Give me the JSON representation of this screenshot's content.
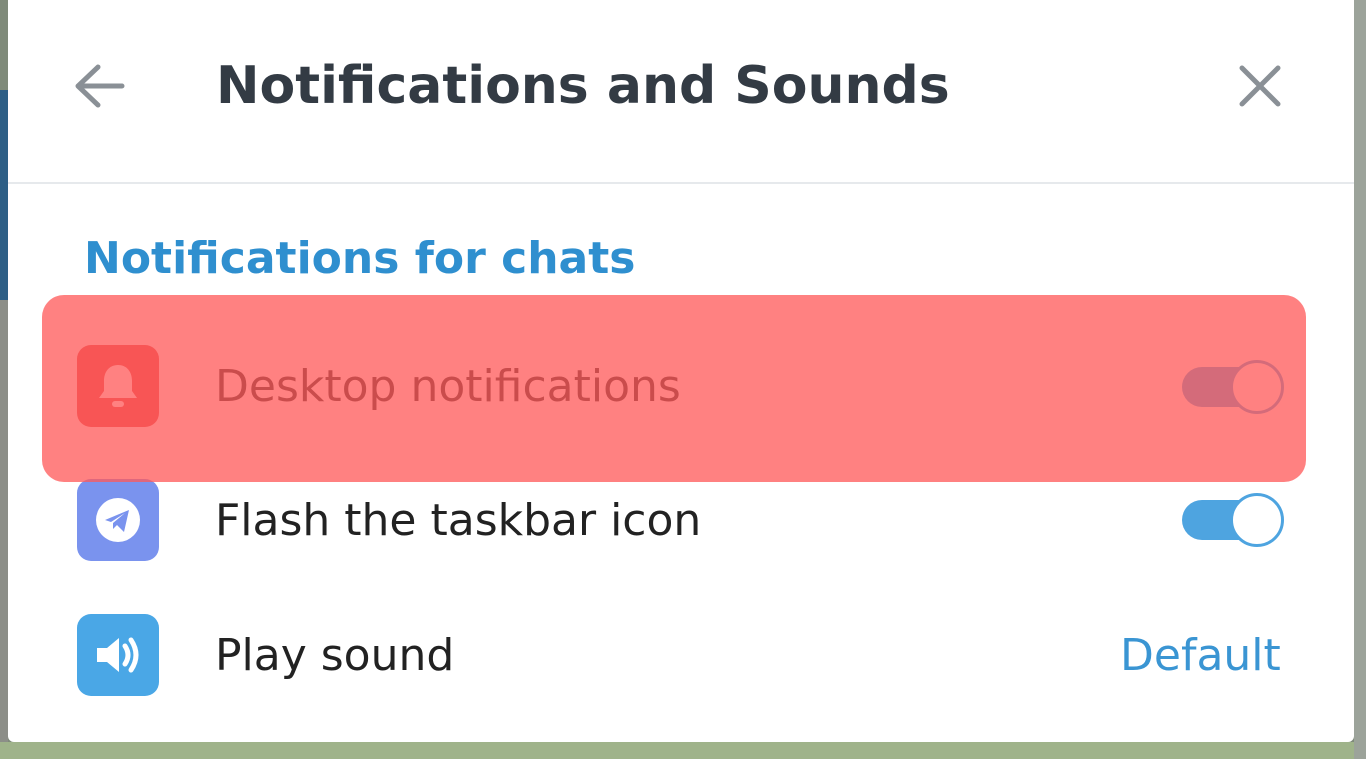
{
  "header": {
    "title": "Notifications and Sounds"
  },
  "section": {
    "title": "Notifications for chats"
  },
  "rows": [
    {
      "label": "Desktop notifications",
      "icon": "bell-icon",
      "icon_color": "#e14a4a",
      "toggle_on": true
    },
    {
      "label": "Flash the taskbar icon",
      "icon": "telegram-plane-icon",
      "icon_color": "#7a93ee",
      "toggle_on": true
    },
    {
      "label": "Play sound",
      "icon": "speaker-icon",
      "icon_color": "#4aa7e6",
      "value": "Default"
    }
  ],
  "colors": {
    "accent": "#3a95d3",
    "highlight": "#ff5a5a"
  }
}
